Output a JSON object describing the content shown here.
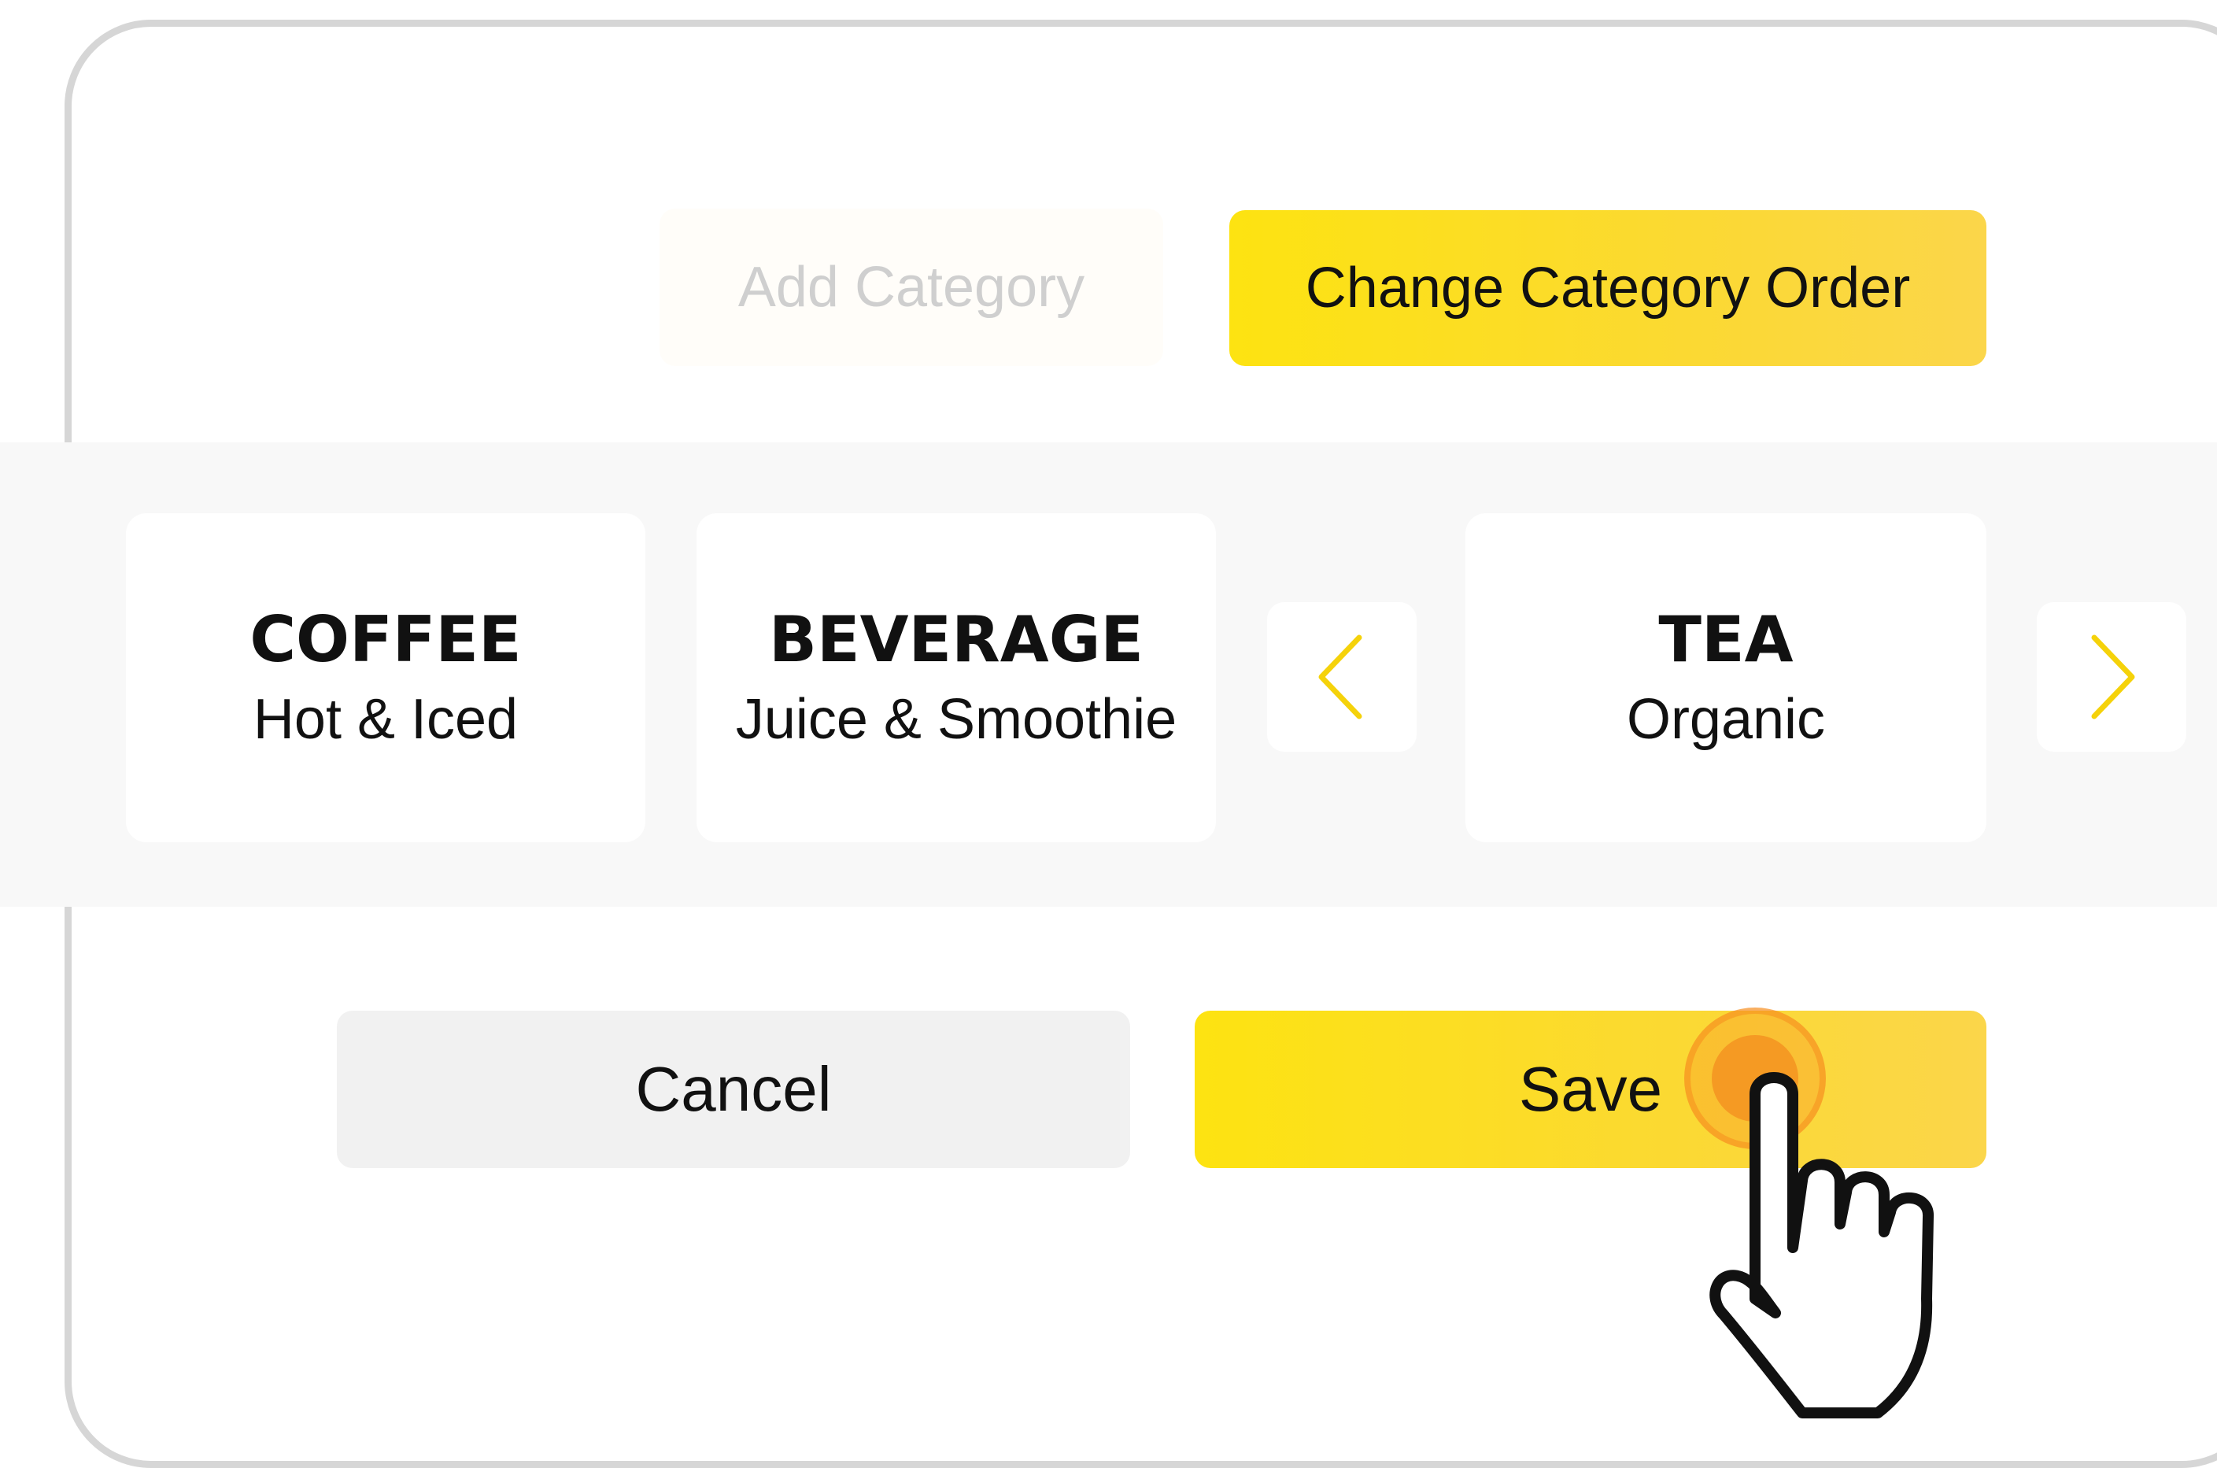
{
  "toolbar": {
    "add_category_label": "Add Category",
    "change_order_label": "Change Category Order"
  },
  "categories": [
    {
      "name": "COFFEE",
      "subtitle": "Hot & Iced",
      "selected": false
    },
    {
      "name": "BEVERAGE",
      "subtitle": "Juice & Smoothie",
      "selected": false
    },
    {
      "name": "TEA",
      "subtitle": "Organic",
      "selected": true
    }
  ],
  "actions": {
    "cancel_label": "Cancel",
    "save_label": "Save"
  },
  "icons": {
    "prev": "chevron-left-icon",
    "next": "chevron-right-icon",
    "cursor": "pointer-hand-icon"
  },
  "colors": {
    "accent": "#fde311",
    "accent_end": "#fbd64a",
    "chevron": "#f5d20a",
    "tap": "#f59a23",
    "muted_text": "#cfcfcf",
    "cancel_bg": "#f1f1f1"
  }
}
